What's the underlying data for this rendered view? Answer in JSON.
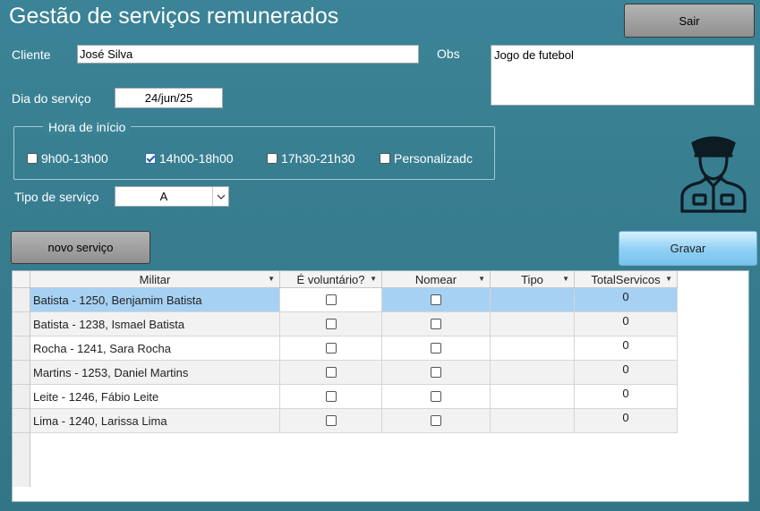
{
  "window": {
    "title": "Gestão de serviços remunerados"
  },
  "buttons": {
    "sair": "Sair",
    "novo": "novo serviço",
    "gravar": "Gravar"
  },
  "cliente": {
    "label": "Cliente",
    "value": "José Silva"
  },
  "obs": {
    "label": "Obs",
    "value": "Jogo de futebol"
  },
  "dia": {
    "label": "Dia do serviço",
    "value": "24/jun/25"
  },
  "hora": {
    "legend": "Hora de início",
    "options": [
      {
        "label": "9h00-13h00",
        "checked": false
      },
      {
        "label": "14h00-18h00",
        "checked": true
      },
      {
        "label": "17h30-21h30",
        "checked": false
      },
      {
        "label": "Personalizadc",
        "checked": false
      }
    ]
  },
  "tipo": {
    "label": "Tipo de serviço",
    "value": "A"
  },
  "icon": "police-officer-icon",
  "grid": {
    "columns": [
      "Militar",
      "É voluntário?",
      "Nomear",
      "Tipo",
      "TotalServicos"
    ],
    "rows": [
      {
        "militar": "Batista - 1250, Benjamim Batista",
        "voluntario": false,
        "nomear": false,
        "tipo": "",
        "total": "0"
      },
      {
        "militar": "Batista - 1238, Ismael Batista",
        "voluntario": false,
        "nomear": false,
        "tipo": "",
        "total": "0"
      },
      {
        "militar": "Rocha - 1241, Sara Rocha",
        "voluntario": false,
        "nomear": false,
        "tipo": "",
        "total": "0"
      },
      {
        "militar": "Martins - 1253, Daniel Martins",
        "voluntario": false,
        "nomear": false,
        "tipo": "",
        "total": "0"
      },
      {
        "militar": "Leite - 1246, Fábio Leite",
        "voluntario": false,
        "nomear": false,
        "tipo": "",
        "total": "0"
      },
      {
        "militar": "Lima - 1240, Larissa Lima",
        "voluntario": false,
        "nomear": false,
        "tipo": "",
        "total": "0"
      }
    ]
  }
}
